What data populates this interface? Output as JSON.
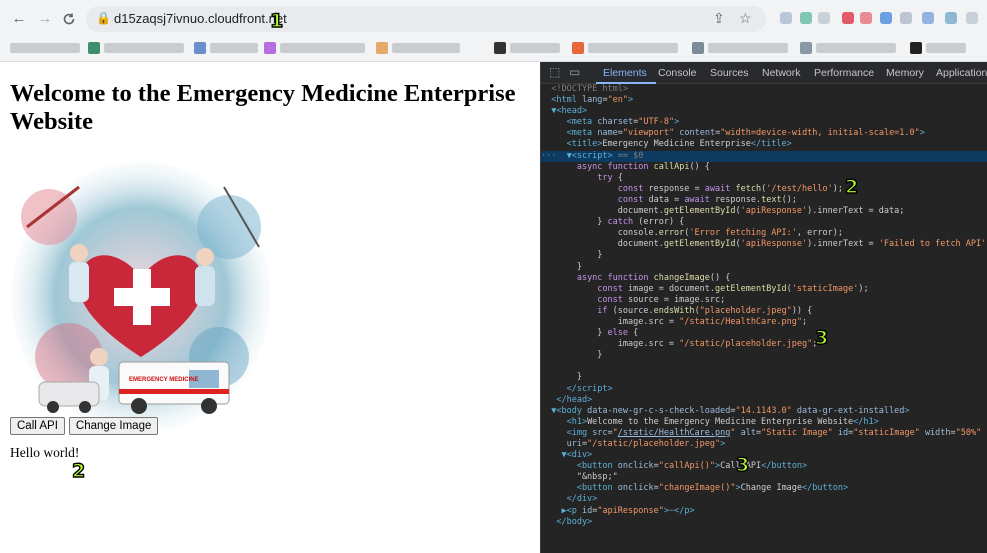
{
  "browser": {
    "url": "d15zaqsj7ivnuo.cloudfront.net",
    "nav": {
      "back": "←",
      "forward": "→",
      "reload": "C"
    }
  },
  "page": {
    "heading": "Welcome to the Emergency Medicine Enterprise Website",
    "image_alt": "Static Image",
    "ambulance_text": "EMERGENCY MEDICINE",
    "buttons": {
      "call_api": "Call API",
      "change_image": "Change Image"
    },
    "api_response": "Hello world!"
  },
  "devtools": {
    "tabs": [
      "Elements",
      "Console",
      "Sources",
      "Network",
      "Performance",
      "Memory",
      "Application"
    ],
    "active_tab": "Elements"
  },
  "annotations": [
    "1",
    "2",
    "2",
    "3",
    "3"
  ]
}
